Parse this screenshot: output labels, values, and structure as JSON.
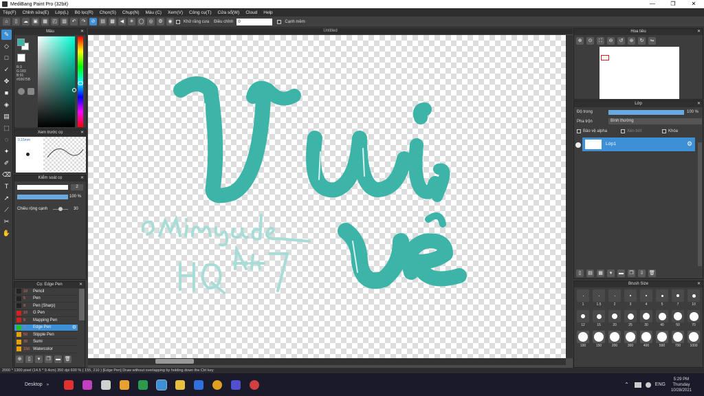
{
  "window": {
    "title": "MediBang Paint Pro (32bit)",
    "minimize": "—",
    "restore": "❐",
    "close": "✕"
  },
  "menu": [
    "Tệp(F)",
    "Chỉnh sửa(E)",
    "Lớp(L)",
    "Bộ lọc(R)",
    "Chọn(S)",
    "Chụp(N)",
    "Màu (C)",
    "Xem(V)",
    "Công cụ(T)",
    "Cửa sổ(W)",
    "Cloud",
    "Help"
  ],
  "toolbar": {
    "antialias_label": "Khử răng cưa",
    "adjust_label": "Điều chỉnh",
    "adjust_value": "0",
    "soft_edge_label": "Cạnh mềm"
  },
  "color_panel": {
    "title": "Màu",
    "r": "R:3",
    "g": "G:183",
    "b": "B:91",
    "hex": "#03675B",
    "fg_color": "#38b6a6",
    "bg_color": "#ffffff"
  },
  "brush_preview": {
    "title": "Xem trước cọ",
    "size": "0.15mm"
  },
  "brush_control": {
    "title": "Kiểm soát cọ",
    "size_value": "2",
    "opacity_value": "100 %",
    "edge_label": "Chiều rộng cạnh",
    "edge_value": "30"
  },
  "brush_list": {
    "title": "Cọ: Edge Pen",
    "items": [
      {
        "size": "10",
        "name": "Pencil",
        "color": "#222222"
      },
      {
        "size": "5",
        "name": "Pen",
        "color": "#222222"
      },
      {
        "size": "8",
        "name": "Pen (Sharp)",
        "color": "#222222"
      },
      {
        "size": "10",
        "name": "G Pen",
        "color": "#d42020"
      },
      {
        "size": "8",
        "name": "Mapping Pen",
        "color": "#d42020"
      },
      {
        "size": "2",
        "name": "Edge Pen",
        "color": "#28c028"
      },
      {
        "size": "50",
        "name": "Stipple Pen",
        "color": "#e8a000"
      },
      {
        "size": "30",
        "name": "Sumi",
        "color": "#e8a000"
      },
      {
        "size": "150",
        "name": "Watercolor",
        "color": "#e8a000"
      }
    ]
  },
  "canvas": {
    "doc_title": "Untitled",
    "ink_color": "#3cb5a8",
    "outline_color": "#a8dcd6"
  },
  "navigator": {
    "title": "Hoa tiêu"
  },
  "layers": {
    "title": "Lớp",
    "opacity_label": "Độ trong",
    "opacity_value": "100 %",
    "blend_label": "Pha trộn",
    "blend_value": "Bình thường",
    "protect_alpha": "Bảo vệ alpha",
    "clipping": "Xén bớt",
    "lock": "Khóa",
    "items": [
      {
        "name": "Lớp1"
      }
    ]
  },
  "brush_size": {
    "title": "Brush Size",
    "sizes": [
      "1",
      "1.5",
      "2",
      "3",
      "4",
      "5",
      "7",
      "10",
      "12",
      "15",
      "20",
      "25",
      "30",
      "40",
      "50",
      "70",
      "100",
      "150",
      "200",
      "300",
      "400",
      "500",
      "700",
      "1000"
    ]
  },
  "status": "2000 * 1300 pixel   (14.5 * 9.4cm)   350 dpi   600 %   ( 155, 210 )   [Edge Pen] Draw without overlapping by holding down the Ctrl key",
  "taskbar": {
    "desktop": "Desktop",
    "lang": "ENG",
    "time": "5:29 PM",
    "day": "Thursday",
    "date": "10/28/2021"
  }
}
